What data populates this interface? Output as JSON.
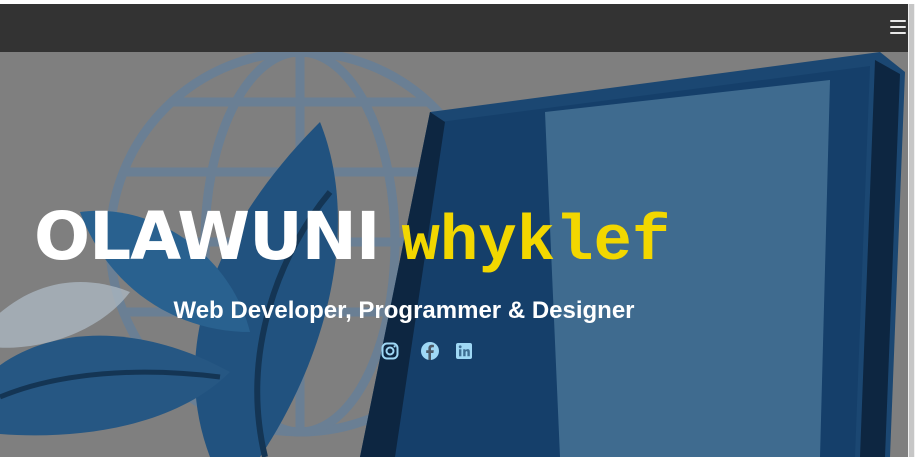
{
  "navbar": {
    "menu_icon": "hamburger-menu-icon"
  },
  "hero": {
    "first_name": "OLAWUNI",
    "last_name": "whyklef",
    "subtitle": "Web Developer, Programmer & Designer",
    "social_icons": [
      "instagram-icon",
      "facebook-icon",
      "linkedin-icon"
    ]
  },
  "colors": {
    "navbar": "#333333",
    "accent_yellow": "#f2d700",
    "icon_blue": "#9fd8f5",
    "hero_overlay": "#8a8a8a"
  }
}
